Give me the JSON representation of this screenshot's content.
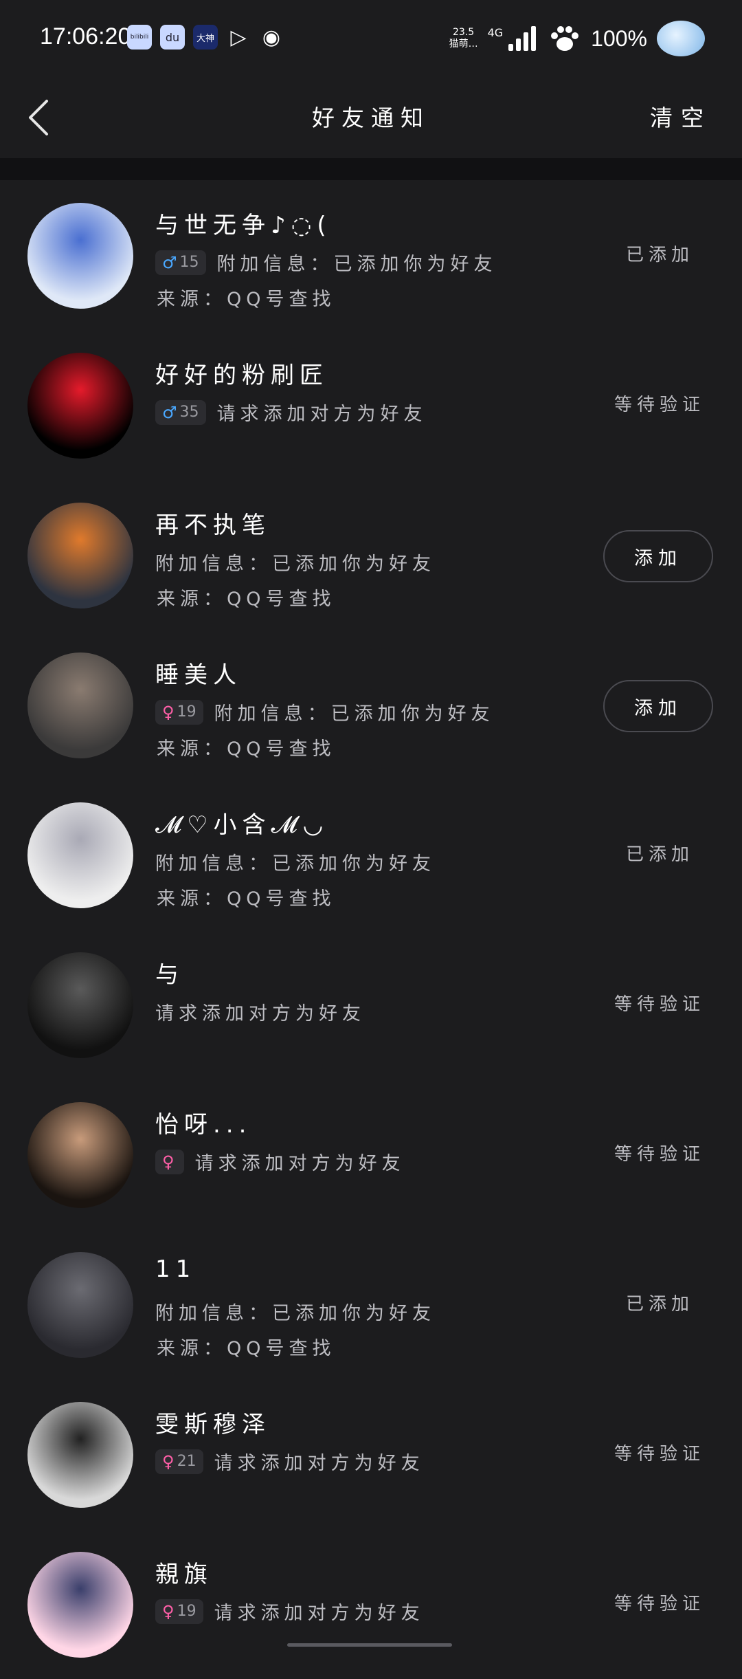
{
  "status_bar": {
    "time": "17:06:20",
    "apps": [
      "bilibili",
      "du",
      "大神",
      "▷",
      "◉"
    ],
    "net_speed": "23.5",
    "net_label": "猫萌…",
    "signal": "4G",
    "battery": "100%"
  },
  "nav": {
    "title": "好友通知",
    "clear_label": "清空"
  },
  "notifications": [
    {
      "name": "与世无争♪◌(",
      "gender": "♂",
      "age": "15",
      "info": "附加信息：已添加你为好友",
      "source": "来源：QQ号查找",
      "status": "已添加",
      "avatar_colors": [
        "#dfe8f7",
        "#4a6fd1"
      ]
    },
    {
      "name": "好好的粉刷匠",
      "gender": "♂",
      "age": "35",
      "info": "请求添加对方为好友",
      "source": "",
      "status": "等待验证",
      "avatar_colors": [
        "#000000",
        "#e51b2b"
      ]
    },
    {
      "name": "再不执笔",
      "gender": "",
      "age": "",
      "info": "附加信息：已添加你为好友",
      "source": "来源：QQ号查找",
      "status": "添加",
      "avatar_colors": [
        "#2e3440",
        "#e07a2c"
      ]
    },
    {
      "name": "睡美人",
      "gender": "♀",
      "age": "19",
      "info": "附加信息：已添加你为好友",
      "source": "来源：QQ号查找",
      "status": "添加",
      "avatar_colors": [
        "#3b3a3a",
        "#8a7b70"
      ]
    },
    {
      "name": "𝓜♡小含𝓜◡",
      "gender": "",
      "age": "",
      "info": "附加信息：已添加你为好友",
      "source": "来源：QQ号查找",
      "status": "已添加",
      "avatar_colors": [
        "#eeeeee",
        "#a9a9b5"
      ]
    },
    {
      "name": "与",
      "gender": "",
      "age": "",
      "info": "请求添加对方为好友",
      "source": "",
      "status": "等待验证",
      "avatar_colors": [
        "#111111",
        "#5a5a5a"
      ]
    },
    {
      "name": "怡呀...",
      "gender": "♀",
      "age": "",
      "info": "请求添加对方为好友",
      "source": "",
      "status": "等待验证",
      "avatar_colors": [
        "#1a1410",
        "#c89b7b"
      ]
    },
    {
      "name": "11",
      "gender": "",
      "age": "",
      "info": "附加信息：已添加你为好友",
      "source": "来源：QQ号查找",
      "status": "已添加",
      "avatar_colors": [
        "#2a2a30",
        "#6b6b72"
      ]
    },
    {
      "name": "雯斯穆泽",
      "gender": "♀",
      "age": "21",
      "info": "请求添加对方为好友",
      "source": "",
      "status": "等待验证",
      "avatar_colors": [
        "#d8d8d8",
        "#222222"
      ]
    },
    {
      "name": "親旗",
      "gender": "♀",
      "age": "19",
      "info": "请求添加对方为好友",
      "source": "",
      "status": "等待验证",
      "avatar_colors": [
        "#ffd6e6",
        "#3a3f6b"
      ]
    }
  ]
}
